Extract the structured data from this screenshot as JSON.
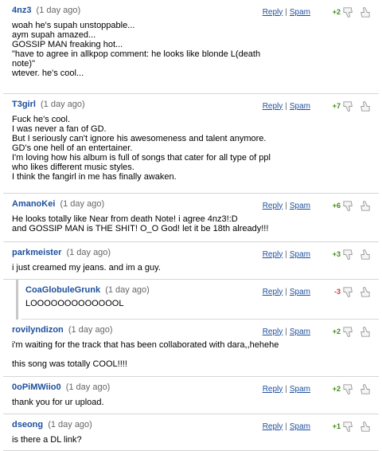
{
  "actions": {
    "reply": "Reply",
    "spam": "Spam",
    "separator": "|"
  },
  "colors": {
    "link": "#1d4f9c",
    "positive": "#3c8a17",
    "negative": "#d2382b"
  },
  "comments": [
    {
      "author": "4nz3",
      "time": "(1 day ago)",
      "score": "+2",
      "sentiment": "positive",
      "lines": [
        "woah he's supah unstoppable...",
        "aym supah amazed...",
        "GOSSIP MAN freaking hot...",
        "\"have to agree in allkpop comment: he looks like blonde L(death",
        "note)\"",
        "wtever. he's cool..."
      ]
    },
    {
      "author": "T3girl",
      "time": "(1 day ago)",
      "score": "+7",
      "sentiment": "positive",
      "lines": [
        "Fuck he's cool.",
        "I was never a fan of GD.",
        "But I seriously can't ignore his awesomeness and talent anymore.",
        "GD's one hell of an entertainer.",
        "I'm loving how his album is full of songs that cater for all type of ppl",
        "who likes different music styles.",
        "I think the fangirl in me has finally awaken."
      ]
    },
    {
      "author": "AmanoKei",
      "time": "(1 day ago)",
      "score": "+6",
      "sentiment": "positive",
      "lines": [
        "He looks totally like Near from death Note! i agree 4nz3!:D",
        "and GOSSIP MAN is THE SHIT! O_O God! let it be 18th already!!!"
      ]
    },
    {
      "author": "parkmeister",
      "time": "(1 day ago)",
      "score": "+3",
      "sentiment": "positive",
      "lines": [
        "i just creamed my jeans. and im a guy."
      ]
    },
    {
      "author": "CoaGlobuleGrunk",
      "time": "(1 day ago)",
      "score": "-3",
      "sentiment": "negative",
      "reply": true,
      "lines": [
        "LOOOOOOOOOOOOOL"
      ]
    },
    {
      "author": "rovilyndizon",
      "time": "(1 day ago)",
      "score": "+2",
      "sentiment": "positive",
      "lines": [
        "i'm waiting for the track that has been collaborated with dara,,hehehe",
        "",
        "this song was totally COOL!!!!"
      ]
    },
    {
      "author": "0oPiMWiio0",
      "time": "(1 day ago)",
      "score": "+2",
      "sentiment": "positive",
      "lines": [
        "thank you for ur upload."
      ]
    },
    {
      "author": "dseong",
      "time": "(1 day ago)",
      "score": "+1",
      "sentiment": "positive",
      "lines": [
        "is there a DL link?"
      ]
    }
  ]
}
